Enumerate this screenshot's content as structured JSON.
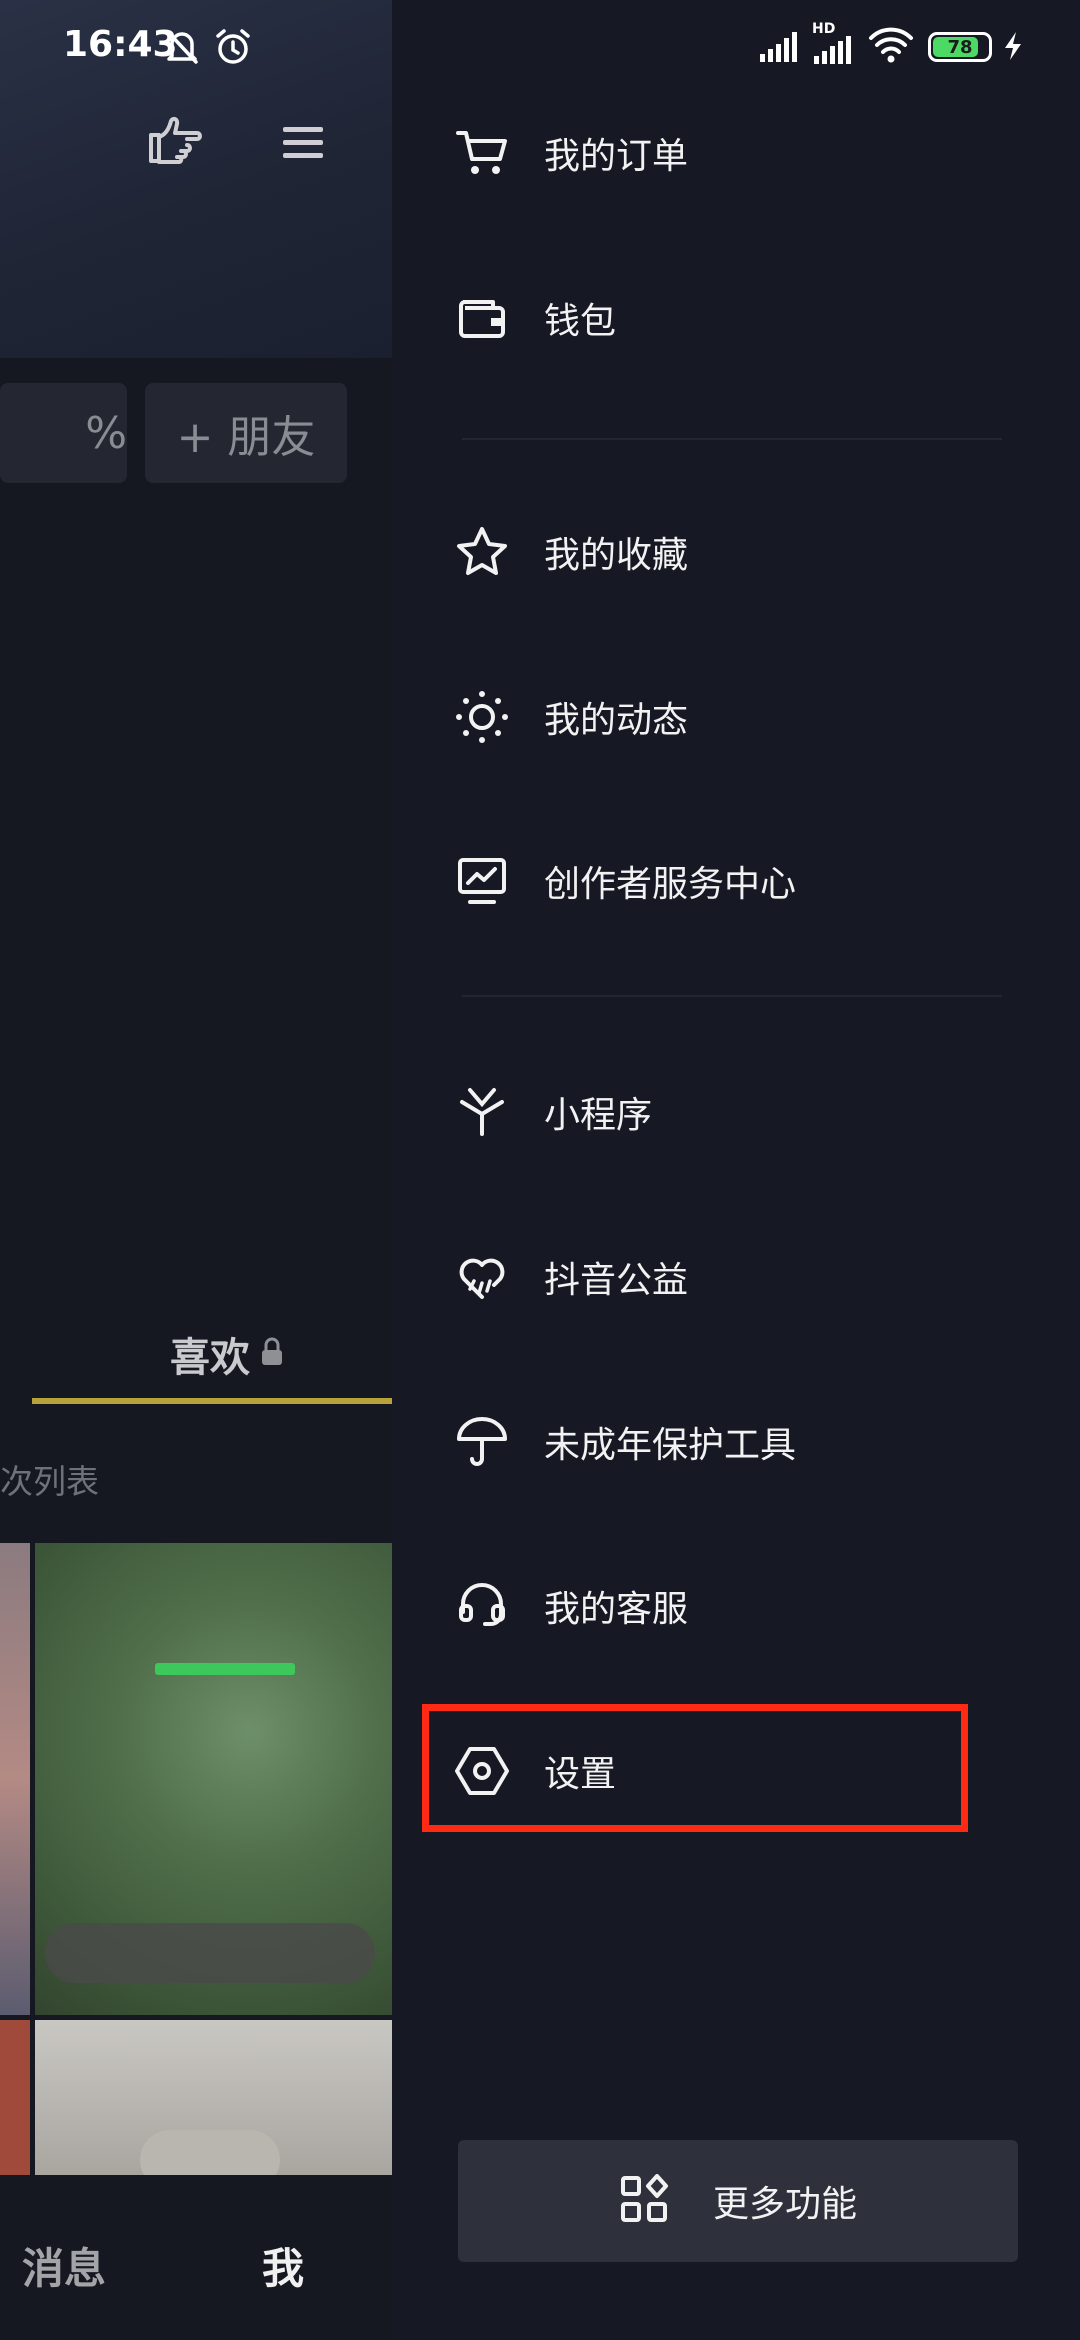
{
  "status_bar": {
    "time": "16:43",
    "battery": "78",
    "network": "HD"
  },
  "background_page": {
    "pill_left_text": "%",
    "add_friend_label": "+ 朋友",
    "likes_tab_label": "喜欢",
    "list_hint": "次列表",
    "nav_messages": "消息",
    "nav_me": "我"
  },
  "drawer": {
    "group1": [
      {
        "label": "我的订单",
        "icon": "cart-icon"
      },
      {
        "label": "钱包",
        "icon": "wallet-icon"
      }
    ],
    "group2": [
      {
        "label": "我的收藏",
        "icon": "star-icon"
      },
      {
        "label": "我的动态",
        "icon": "sun-icon"
      },
      {
        "label": "创作者服务中心",
        "icon": "monitor-chart-icon"
      }
    ],
    "group3": [
      {
        "label": "小程序",
        "icon": "mini-program-icon"
      },
      {
        "label": "抖音公益",
        "icon": "charity-heart-icon"
      },
      {
        "label": "未成年保护工具",
        "icon": "umbrella-icon"
      },
      {
        "label": "我的客服",
        "icon": "headset-icon"
      },
      {
        "label": "设置",
        "icon": "settings-hex-icon"
      }
    ],
    "more_label": "更多功能",
    "highlight_color": "#ff2a14"
  }
}
